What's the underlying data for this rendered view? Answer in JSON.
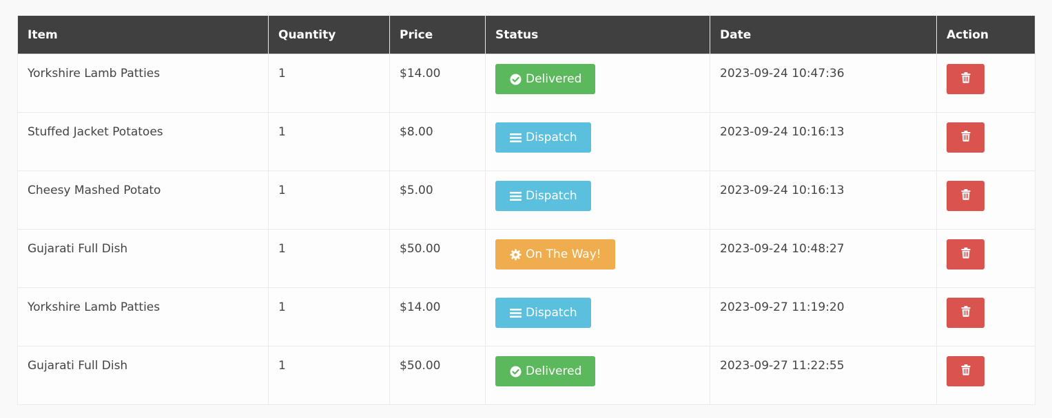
{
  "table": {
    "headers": {
      "item": "Item",
      "quantity": "Quantity",
      "price": "Price",
      "status": "Status",
      "date": "Date",
      "action": "Action"
    },
    "rows": [
      {
        "item": "Yorkshire Lamb Patties",
        "quantity": "1",
        "price": "$14.00",
        "status": "Delivered",
        "status_icon": "check-circle-icon",
        "status_color": "#5cb85c",
        "date": "2023-09-24 10:47:36"
      },
      {
        "item": "Stuffed Jacket Potatoes",
        "quantity": "1",
        "price": "$8.00",
        "status": "Dispatch",
        "status_icon": "bars-icon",
        "status_color": "#5bc0de",
        "date": "2023-09-24 10:16:13"
      },
      {
        "item": "Cheesy Mashed Potato",
        "quantity": "1",
        "price": "$5.00",
        "status": "Dispatch",
        "status_icon": "bars-icon",
        "status_color": "#5bc0de",
        "date": "2023-09-24 10:16:13"
      },
      {
        "item": "Gujarati Full Dish",
        "quantity": "1",
        "price": "$50.00",
        "status": "On The Way!",
        "status_icon": "gear-icon",
        "status_color": "#f0ad4e",
        "date": "2023-09-24 10:48:27"
      },
      {
        "item": "Yorkshire Lamb Patties",
        "quantity": "1",
        "price": "$14.00",
        "status": "Dispatch",
        "status_icon": "bars-icon",
        "status_color": "#5bc0de",
        "date": "2023-09-27 11:19:20"
      },
      {
        "item": "Gujarati Full Dish",
        "quantity": "1",
        "price": "$50.00",
        "status": "Delivered",
        "status_icon": "check-circle-icon",
        "status_color": "#5cb85c",
        "date": "2023-09-27 11:22:55"
      }
    ],
    "action_icon": "trash-icon",
    "action_color": "#d9534f",
    "header_bg": "#404040"
  }
}
